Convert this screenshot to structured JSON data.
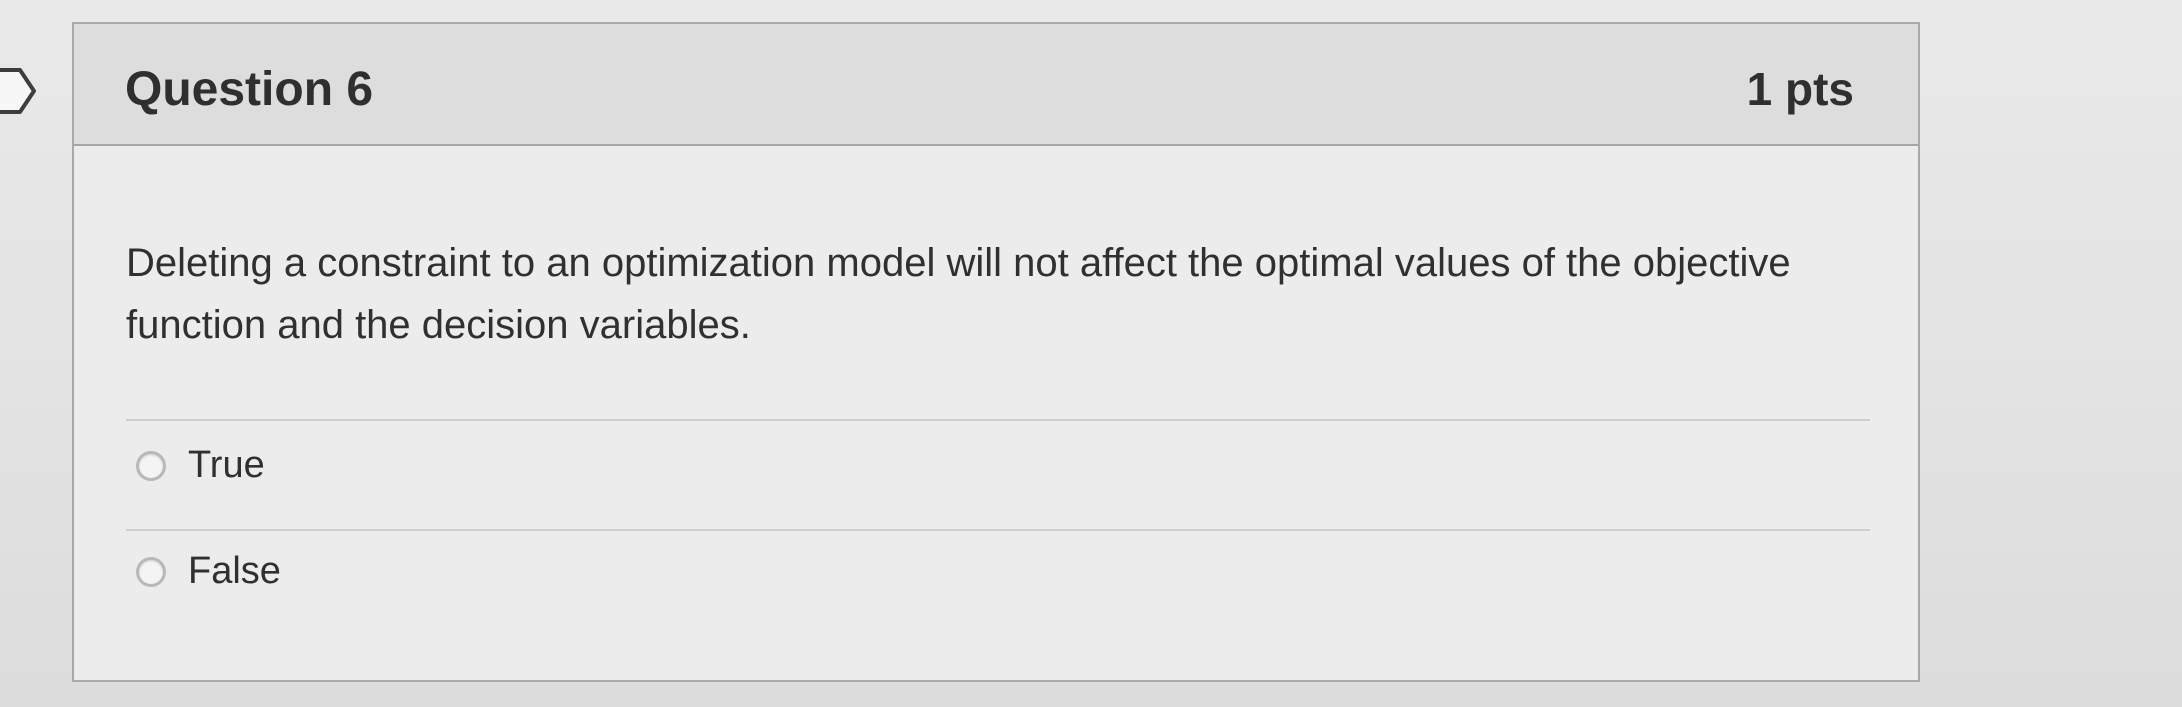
{
  "question": {
    "title": "Question 6",
    "points": "1 pts",
    "text": "Deleting a constraint to an optimization model will not affect the optimal values of the objective function and the decision variables."
  },
  "answers": [
    {
      "label": "True",
      "selected": false
    },
    {
      "label": "False",
      "selected": false
    }
  ],
  "icons": {
    "marker": "flag-marker-icon",
    "radio": "radio-button-icon"
  }
}
